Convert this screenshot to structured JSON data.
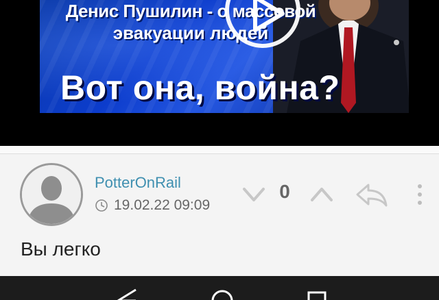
{
  "video": {
    "title_line1": "Денис Пушилин - о массовой",
    "title_line2": "эвакуации людей",
    "headline": "Вот она, война?",
    "play_icon": "play-icon",
    "colors": {
      "background": "#0c3ccc",
      "text": "#ffffff"
    }
  },
  "comment": {
    "author": "PotterOnRail",
    "timestamp": "19.02.22 09:09",
    "score": "0",
    "text": "Вы легко",
    "avatar_icon": "user-avatar-icon",
    "colors": {
      "author": "#3f8fb0",
      "meta": "#666666"
    }
  },
  "navbar": {
    "icons": [
      "back-icon",
      "home-icon",
      "recent-apps-icon"
    ]
  }
}
